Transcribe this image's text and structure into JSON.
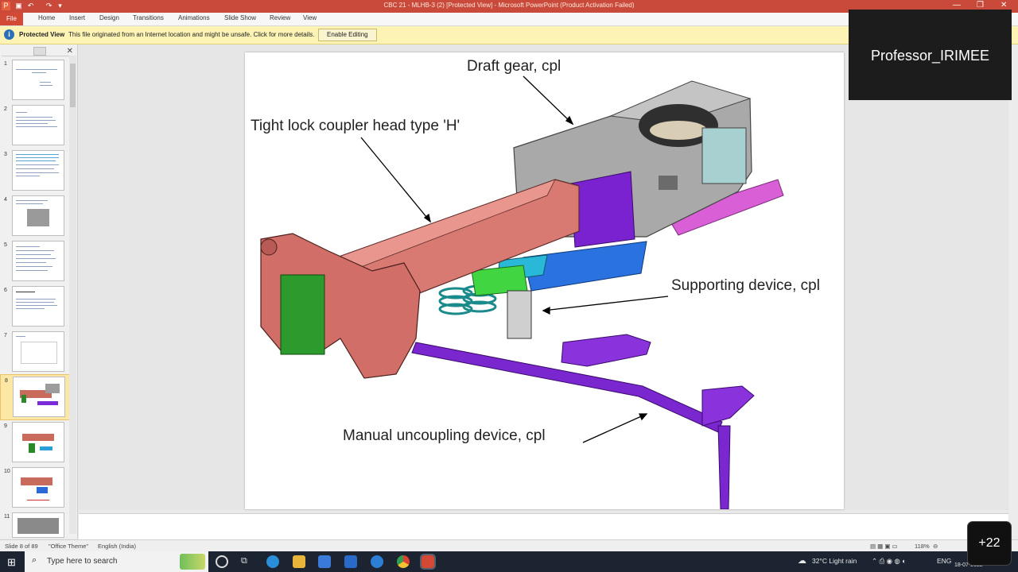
{
  "window": {
    "title": "CBC 21 - MLHB-3 (2) [Protected View] - Microsoft PowerPoint (Product Activation Failed)",
    "ribbon_tabs": [
      "File",
      "Home",
      "Insert",
      "Design",
      "Transitions",
      "Animations",
      "Slide Show",
      "Review",
      "View"
    ]
  },
  "protected_view": {
    "label": "Protected View",
    "message": "This file originated from an Internet location and might be unsafe. Click for more details.",
    "button": "Enable Editing"
  },
  "thumbnails": {
    "numbers": [
      "1",
      "2",
      "3",
      "4",
      "5",
      "6",
      "7",
      "8",
      "9",
      "10",
      "11"
    ],
    "selected_index": 8
  },
  "slide": {
    "callouts": {
      "draft_gear": "Draft gear, cpl",
      "coupler_head": "Tight lock coupler head type 'H'",
      "supporting": "Supporting device, cpl",
      "uncoupling": "Manual uncoupling device, cpl"
    }
  },
  "status_bar": {
    "slide_info": "Slide 8 of 89",
    "theme": "\"Office Theme\"",
    "language": "English (India)",
    "zoom": "118%"
  },
  "taskbar": {
    "search_placeholder": "Type here to search",
    "weather": "32°C  Light rain",
    "lang": "ENG",
    "date": "18-07-2022"
  },
  "overlay": {
    "presenter": "Professor_IRIMEE",
    "participants": "+22"
  },
  "colors": {
    "titlebar": "#c94a3a",
    "protected_bar": "#fcf3b4",
    "taskbar": "#1b2430",
    "selected_thumb": "#fde7a5"
  }
}
